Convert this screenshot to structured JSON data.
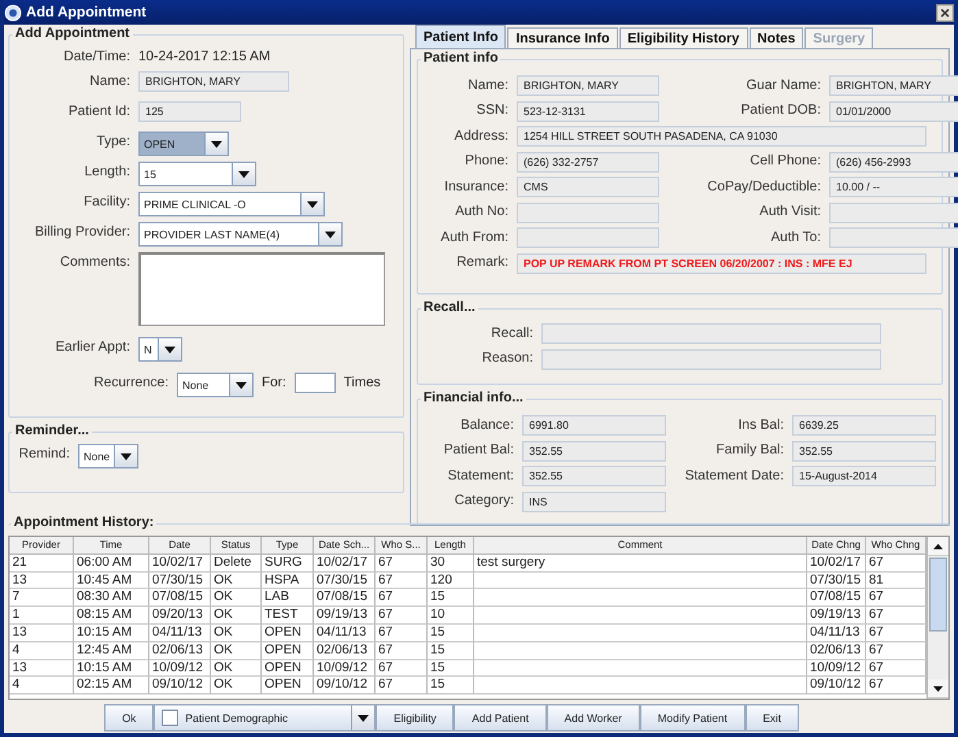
{
  "window": {
    "title": "Add Appointment"
  },
  "appointment": {
    "title": "Add Appointment",
    "fields": [
      {
        "label": "Date/Time:",
        "kind": "text",
        "value": "10-24-2017 12:15 AM"
      },
      {
        "label": "Name:",
        "kind": "field",
        "value": "BRIGHTON, MARY"
      },
      {
        "label": "Patient Id:",
        "kind": "field",
        "value": "125"
      },
      {
        "label": "Type:",
        "kind": "select",
        "value": "OPEN",
        "focused": true
      },
      {
        "label": "Length:",
        "kind": "select",
        "value": "15",
        "focused": false
      },
      {
        "label": "Facility:",
        "kind": "select",
        "value": "PRIME CLINICAL -O",
        "focused": false
      },
      {
        "label": "Billing Provider:",
        "kind": "select",
        "value": "PROVIDER LAST NAME(4)",
        "focused": false
      },
      {
        "label": "Comments:",
        "kind": "textarea"
      },
      {
        "label": "Earlier Appt:",
        "kind": "select",
        "value": "N",
        "focused": false
      }
    ],
    "recurrence": {
      "label": "Recurrence:",
      "value": "None",
      "for_label": "For:",
      "times_label": "Times"
    }
  },
  "reminder": {
    "title": "Reminder...",
    "label": "Remind:",
    "value": "None"
  },
  "tabs": [
    {
      "label": "Patient Info",
      "selected": true,
      "disabled": false
    },
    {
      "label": "Insurance Info",
      "selected": false,
      "disabled": false
    },
    {
      "label": "Eligibility History",
      "selected": false,
      "disabled": false
    },
    {
      "label": "Notes",
      "selected": false,
      "disabled": false
    },
    {
      "label": "Surgery",
      "selected": false,
      "disabled": true
    }
  ],
  "patient_info": {
    "title": "Patient info",
    "rows": [
      {
        "kind": "pair",
        "cells": [
          {
            "label": "Name:",
            "value": "BRIGHTON, MARY"
          },
          {
            "label": "Guar Name:",
            "value": "BRIGHTON, MARY"
          }
        ]
      },
      {
        "kind": "pair",
        "cells": [
          {
            "label": "SSN:",
            "value": "523-12-3131"
          },
          {
            "label": "Patient DOB:",
            "value": "01/01/2000"
          }
        ]
      },
      {
        "kind": "wide",
        "cells": [
          {
            "label": "Address:",
            "value": "1254 HILL STREET SOUTH PASADENA, CA 91030"
          }
        ]
      },
      {
        "kind": "pair",
        "cells": [
          {
            "label": "Phone:",
            "value": "(626) 332-2757"
          },
          {
            "label": "Cell Phone:",
            "value": "(626) 456-2993"
          }
        ]
      },
      {
        "kind": "pair",
        "cells": [
          {
            "label": "Insurance:",
            "value": "CMS"
          },
          {
            "label": "CoPay/Deductible:",
            "value": "10.00  /  --"
          }
        ]
      },
      {
        "kind": "pair",
        "cells": [
          {
            "label": "Auth No:"
          },
          {
            "label": "Auth Visit:"
          }
        ]
      },
      {
        "kind": "pair",
        "cells": [
          {
            "label": "Auth From:"
          },
          {
            "label": "Auth To:"
          }
        ]
      },
      {
        "kind": "alert",
        "cells": [
          {
            "label": "Remark:",
            "value": "POP UP REMARK FROM PT SCREEN   06/20/2007 : INS : MFE EJ"
          }
        ]
      }
    ]
  },
  "recall": {
    "title": "Recall...",
    "fields": [
      {
        "label": "Recall:"
      },
      {
        "label": "Reason:"
      }
    ]
  },
  "financial": {
    "title": "Financial info...",
    "rows": [
      {
        "cells": [
          {
            "label": "Balance:",
            "value": "6991.80"
          },
          {
            "label": "Ins Bal:",
            "value": "6639.25"
          }
        ]
      },
      {
        "cells": [
          {
            "label": "Patient Bal:",
            "value": "352.55"
          },
          {
            "label": "Family Bal:",
            "value": "352.55"
          }
        ]
      },
      {
        "cells": [
          {
            "label": "Statement:",
            "value": "352.55"
          },
          {
            "label": "Statement Date:",
            "value": "15-August-2014"
          }
        ]
      },
      {
        "cells": [
          {
            "label": "Category:",
            "value": "INS"
          }
        ]
      }
    ]
  },
  "history": {
    "title": "Appointment History:",
    "columns": [
      "Provider",
      "Time",
      "Date",
      "Status",
      "Type",
      "Date Sch...",
      "Who S...",
      "Length",
      "Comment",
      "Date Chng",
      "Who Chng"
    ],
    "rows": [
      [
        "21",
        "06:00 AM",
        "10/02/17",
        "Delete",
        "SURG",
        "10/02/17",
        "67",
        "30",
        "test surgery",
        "10/02/17",
        "67"
      ],
      [
        "13",
        "10:45 AM",
        "07/30/15",
        "OK",
        "HSPA",
        "07/30/15",
        "67",
        "120",
        "",
        "07/30/15",
        "81"
      ],
      [
        "7",
        "08:30 AM",
        "07/08/15",
        "OK",
        "LAB",
        "07/08/15",
        "67",
        "15",
        "",
        "07/08/15",
        "67"
      ],
      [
        "1",
        "08:15 AM",
        "09/20/13",
        "OK",
        "TEST",
        "09/19/13",
        "67",
        "10",
        "",
        "09/19/13",
        "67"
      ],
      [
        "13",
        "10:15 AM",
        "04/11/13",
        "OK",
        "OPEN",
        "04/11/13",
        "67",
        "15",
        "",
        "04/11/13",
        "67"
      ],
      [
        "4",
        "12:45 AM",
        "02/06/13",
        "OK",
        "OPEN",
        "02/06/13",
        "67",
        "15",
        "",
        "02/06/13",
        "67"
      ],
      [
        "13",
        "10:15 AM",
        "10/09/12",
        "OK",
        "OPEN",
        "10/09/12",
        "67",
        "15",
        "",
        "10/09/12",
        "67"
      ],
      [
        "4",
        "02:15 AM",
        "09/10/12",
        "OK",
        "OPEN",
        "09/10/12",
        "67",
        "15",
        "",
        "09/10/12",
        "67"
      ]
    ]
  },
  "buttons": [
    {
      "kind": "button",
      "label": "Ok"
    },
    {
      "kind": "check",
      "label": "Patient Demographic",
      "checked": false
    },
    {
      "kind": "button",
      "label": "Eligibility"
    },
    {
      "kind": "button",
      "label": "Add Patient"
    },
    {
      "kind": "button",
      "label": "Add Worker"
    },
    {
      "kind": "button",
      "label": "Modify Patient"
    },
    {
      "kind": "button",
      "label": "Exit"
    }
  ]
}
